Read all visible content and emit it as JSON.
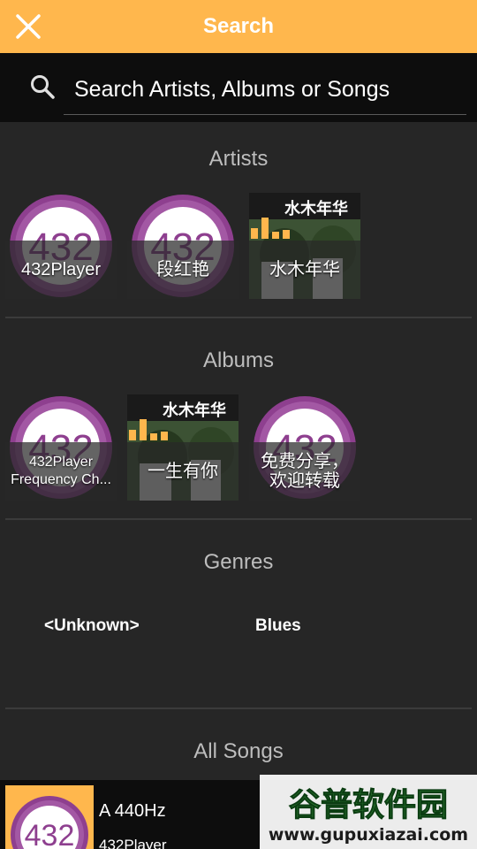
{
  "header": {
    "title": "Search",
    "close_icon": "close-icon"
  },
  "search": {
    "placeholder": "Search Artists, Albums or Songs",
    "icon": "search-icon"
  },
  "sections": {
    "artists": {
      "title": "Artists",
      "items": [
        {
          "label": "432Player",
          "art": "432-logo",
          "art_text": "432"
        },
        {
          "label": "段红艳",
          "art": "432-logo",
          "art_text": "432"
        },
        {
          "label": "水木年华",
          "art": "album-cover",
          "art_text": "水木年华"
        }
      ]
    },
    "albums": {
      "title": "Albums",
      "items": [
        {
          "label_line1": "432Player",
          "label_line2": "Frequency Ch...",
          "art": "432-logo",
          "art_text": "432"
        },
        {
          "label": "一生有你",
          "art": "album-cover",
          "art_text": "水木年华"
        },
        {
          "label_line1": "免费分享，",
          "label_line2": "欢迎转载",
          "art": "432-logo",
          "art_text": "432"
        }
      ]
    },
    "genres": {
      "title": "Genres",
      "items": [
        "<Unknown>",
        "Blues"
      ]
    },
    "songs": {
      "title": "All Songs",
      "items": [
        {
          "title": "A 440Hz",
          "artist": "432Player",
          "art_text": "432"
        }
      ]
    }
  },
  "watermark": {
    "line1": "谷普软件园",
    "line2": "www.gupuxiazai.com"
  },
  "colors": {
    "accent": "#ffb74d",
    "background": "#262626",
    "bar": "#0d0d0d",
    "logo_purple": "#8e3f8f"
  }
}
